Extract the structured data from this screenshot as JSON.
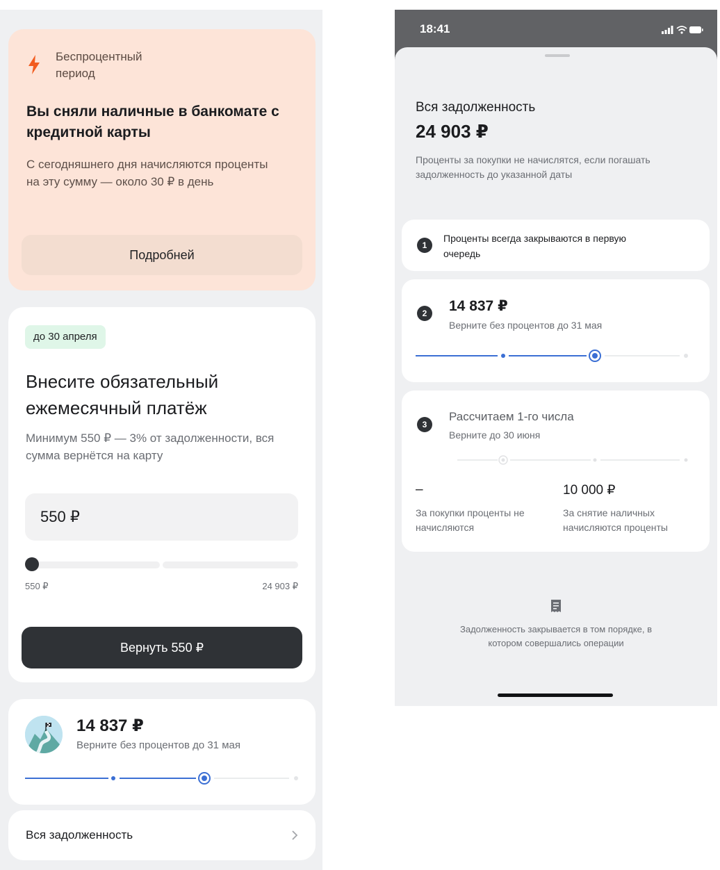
{
  "left": {
    "promo": {
      "tag": "Беспроцентный период",
      "title": "Вы сняли наличные в банкомате с кредитной карты",
      "text": "С сегодняшнего дня начисляются проценты на эту сумму — около 30 ₽ в день",
      "button": "Подробней"
    },
    "payment": {
      "badge": "до 30 апреля",
      "title": "Внесите обязательный ежемесячный платёж",
      "subtitle": "Минимум 550 ₽ — 3% от задолженности, вся сумма вернётся на карту",
      "amount": "550 ₽",
      "slider_min": "550 ₽",
      "slider_max": "24 903 ₽",
      "slider_level": 0.0,
      "button": "Вернуть 550 ₽"
    },
    "goal": {
      "amount": "14 837 ₽",
      "subtitle": "Верните без процентов до 31 мая"
    },
    "debt_row": {
      "label": "Вся задолженность"
    }
  },
  "right": {
    "status": {
      "time": "18:41"
    },
    "sheet": {
      "title": "Вся задолженность",
      "amount": "24 903 ₽",
      "description": "Проценты за покупки не начислятся, если погашать задолженность до указанной даты"
    },
    "steps": [
      {
        "number": "1",
        "text": "Проценты всегда закрываются в первую очередь"
      },
      {
        "number": "2",
        "amount": "14 837 ₽",
        "subtitle": "Верните без процентов до 31 мая"
      },
      {
        "number": "3",
        "title": "Рассчитаем 1-го числа",
        "subtitle": "Верните до 30 июня",
        "col_a_value": "–",
        "col_a_text": "За покупки проценты не начисляются",
        "col_b_value": "10 000 ₽",
        "col_b_text": "За снятие наличных начисляются проценты"
      }
    ],
    "note": "Задолженность закрывается в том порядке, в котором совершались операции"
  },
  "colors": {
    "accent": "#3b6fd4",
    "promo_bg": "#fde4d8",
    "dark_button": "#2f3236",
    "bolt": "#f25c1f",
    "badge_bg": "#dff6e8"
  },
  "icons": [
    "lightning-icon",
    "mountain-flag-avatar-icon",
    "chevron-right-icon",
    "signal-icon",
    "wifi-icon",
    "battery-icon",
    "receipt-icon"
  ]
}
